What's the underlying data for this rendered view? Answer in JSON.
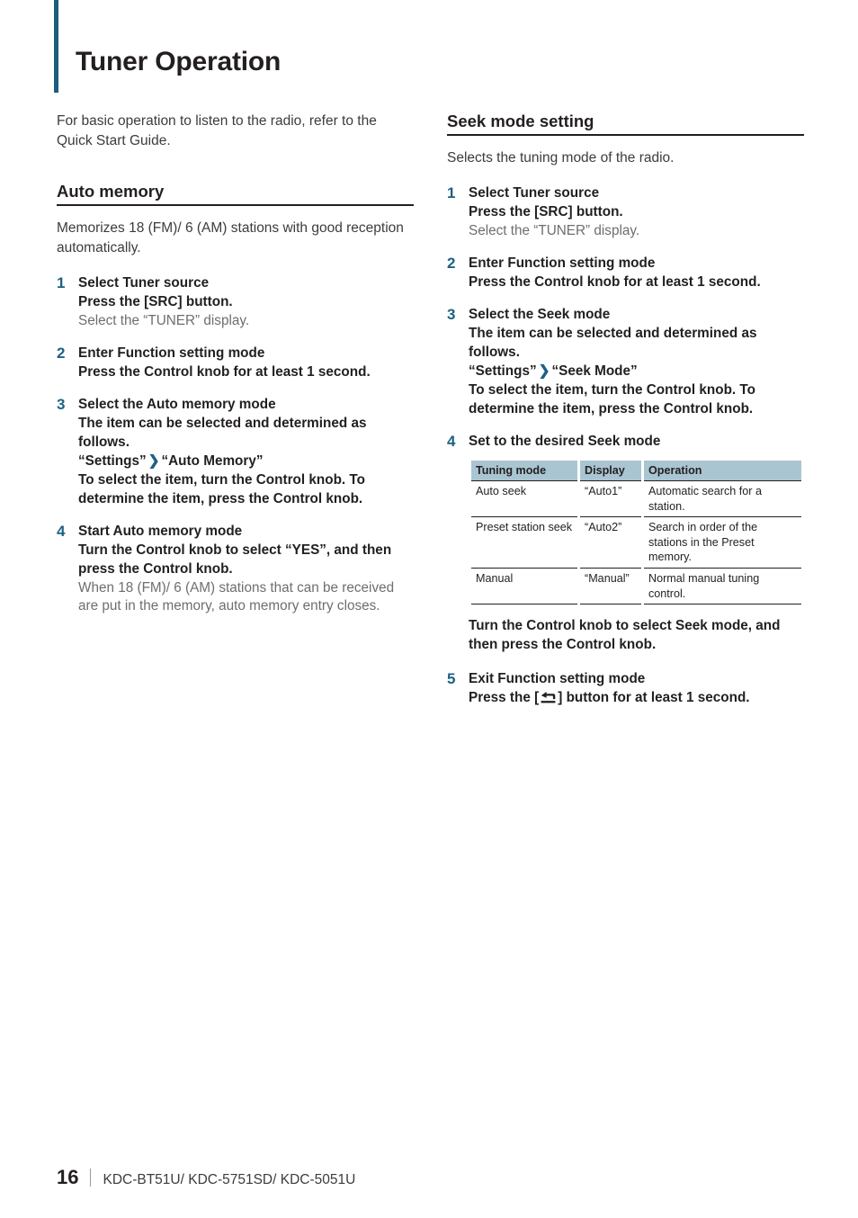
{
  "page": {
    "title": "Tuner Operation",
    "accent_color": "#1d5c7e",
    "step_number_color": "#1d6183",
    "table_header_color": "#a9c5d2"
  },
  "intro": "For basic operation to listen to the radio, refer to the Quick Start Guide.",
  "left_column": {
    "section": {
      "heading": "Auto memory",
      "description": "Memorizes 18 (FM)/ 6 (AM) stations with good reception automatically.",
      "steps": [
        {
          "num": "1",
          "lines": [
            {
              "text": "Select Tuner source",
              "style": "bold"
            },
            {
              "text": "Press the [SRC] button.",
              "style": "bold"
            },
            {
              "text": "Select the “TUNER” display.",
              "style": "normal"
            }
          ]
        },
        {
          "num": "2",
          "lines": [
            {
              "text": "Enter Function setting mode",
              "style": "bold"
            },
            {
              "text": "Press the Control knob for at least 1 second.",
              "style": "bold"
            }
          ]
        },
        {
          "num": "3",
          "lines": [
            {
              "text": "Select the Auto memory mode",
              "style": "bold"
            },
            {
              "text": "The item can be selected and determined as follows.",
              "style": "bold"
            },
            {
              "text": "“Settings” ❯ “Auto Memory”",
              "style": "bold",
              "path": true
            },
            {
              "text": "To select the item, turn the Control knob. To determine the item, press the Control knob.",
              "style": "bold"
            }
          ]
        },
        {
          "num": "4",
          "lines": [
            {
              "text": "Start Auto memory mode",
              "style": "bold"
            },
            {
              "text": "Turn the Control knob to select “YES”, and then press the Control knob.",
              "style": "bold"
            },
            {
              "text": "When 18 (FM)/ 6 (AM) stations that can be received are put in the memory, auto memory entry closes.",
              "style": "normal"
            }
          ]
        }
      ],
      "path_parts": {
        "settings": "“Settings”",
        "chevron": "❯",
        "target": "“Auto Memory”"
      }
    }
  },
  "right_column": {
    "section": {
      "heading": "Seek mode setting",
      "description": "Selects the tuning mode of the radio.",
      "steps_before_table": [
        {
          "num": "1",
          "lines": [
            {
              "text": "Select Tuner source",
              "style": "bold"
            },
            {
              "text": "Press the [SRC] button.",
              "style": "bold"
            },
            {
              "text": "Select the “TUNER” display.",
              "style": "normal"
            }
          ]
        },
        {
          "num": "2",
          "lines": [
            {
              "text": "Enter Function setting mode",
              "style": "bold"
            },
            {
              "text": "Press the Control knob for at least 1 second.",
              "style": "bold"
            }
          ]
        },
        {
          "num": "3",
          "lines": [
            {
              "text": "Select the Seek mode",
              "style": "bold"
            },
            {
              "text": "The item can be selected and determined as follows.",
              "style": "bold"
            },
            {
              "text": "“Settings” ❯ “Seek Mode”",
              "style": "bold",
              "path": true
            },
            {
              "text": "To select the item, turn the Control knob. To determine the item, press the Control knob.",
              "style": "bold"
            }
          ]
        }
      ],
      "path_parts": {
        "settings": "“Settings”",
        "chevron": "❯",
        "target": "“Seek Mode”"
      },
      "step4": {
        "num": "4",
        "title": "Set to the desired Seek mode"
      },
      "table": {
        "headers": [
          "Tuning mode",
          "Display",
          "Operation"
        ],
        "rows": [
          [
            "Auto seek",
            "“Auto1”",
            "Automatic search for a station."
          ],
          [
            "Preset station seek",
            "“Auto2”",
            "Search in order of the stations in the Preset memory."
          ],
          [
            "Manual",
            "“Manual”",
            "Normal manual tuning control."
          ]
        ]
      },
      "after_table": "Turn the Control knob to select Seek mode, and then press the Control knob.",
      "step5": {
        "num": "5",
        "title": "Exit Function setting mode",
        "instruction_before": "Press the [",
        "instruction_after": "] button for at least 1 second.",
        "icon": "back-arrow-icon"
      }
    }
  },
  "footer": {
    "page_number": "16",
    "models": "KDC-BT51U/ KDC-5751SD/ KDC-5051U"
  }
}
